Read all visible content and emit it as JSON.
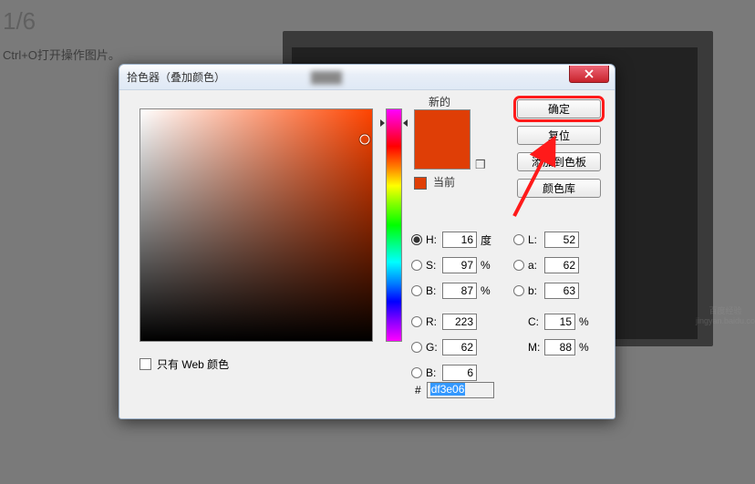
{
  "page": {
    "step": "1/6",
    "hint": "Ctrl+O打开操作图片。"
  },
  "dialog": {
    "title": "拾色器（叠加颜色）",
    "close_label": "x",
    "new_label": "新的",
    "current_label": "当前",
    "buttons": {
      "ok": "确定",
      "reset": "复位",
      "add_swatch": "添加到色板",
      "color_libs": "颜色库"
    },
    "fields": {
      "H": {
        "label": "H:",
        "value": "16",
        "unit": "度"
      },
      "S": {
        "label": "S:",
        "value": "97",
        "unit": "%"
      },
      "Bv": {
        "label": "B:",
        "value": "87",
        "unit": "%"
      },
      "R": {
        "label": "R:",
        "value": "223"
      },
      "G": {
        "label": "G:",
        "value": "62"
      },
      "Bb": {
        "label": "B:",
        "value": "6"
      },
      "L": {
        "label": "L:",
        "value": "52"
      },
      "a": {
        "label": "a:",
        "value": "62"
      },
      "b": {
        "label": "b:",
        "value": "63"
      },
      "C": {
        "label": "C:",
        "value": "15",
        "unit": "%"
      },
      "M": {
        "label": "M:",
        "value": "88",
        "unit": "%"
      }
    },
    "hex": {
      "label": "#",
      "value": "df3e06"
    },
    "web_only": "只有 Web 颜色",
    "colors": {
      "new": "#df3e06",
      "current": "#df3e06"
    },
    "sv_cursor": {
      "x_pct": 97,
      "y_pct": 13
    },
    "hue_pos_pct": 6
  },
  "watermark": "百度经验 jingyan.baidu.com"
}
